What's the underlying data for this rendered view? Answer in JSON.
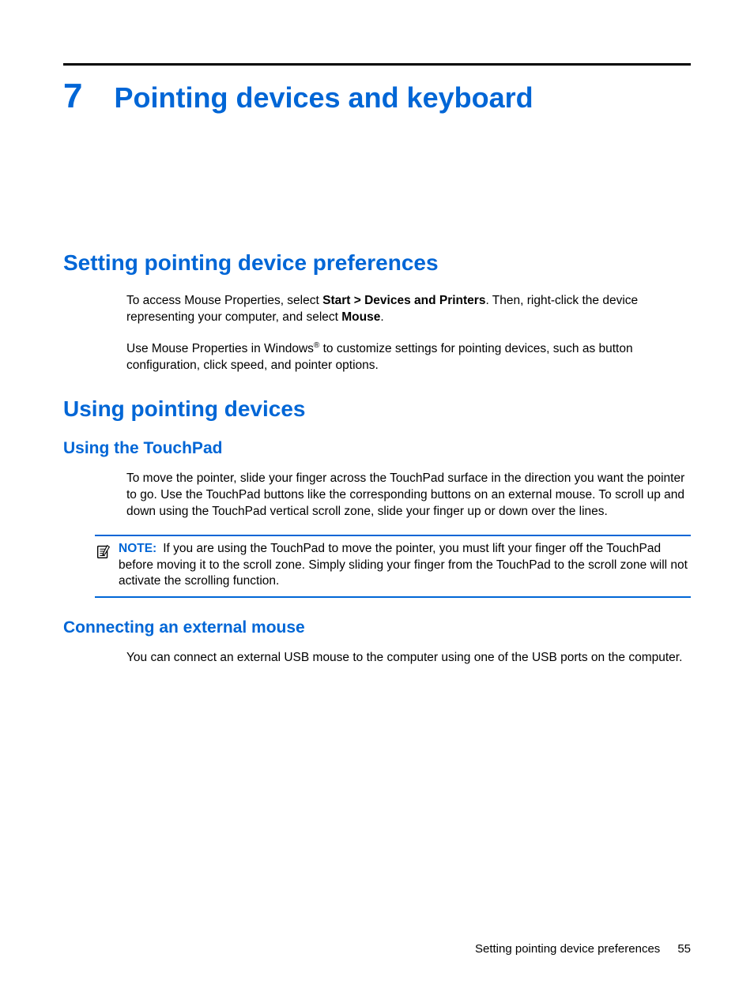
{
  "chapter": {
    "number": "7",
    "title": "Pointing devices and keyboard"
  },
  "sections": {
    "setting_prefs": {
      "heading": "Setting pointing device preferences",
      "para1_pre": "To access Mouse Properties, select ",
      "para1_b1": "Start > Devices and Printers",
      "para1_mid": ". Then, right-click the device representing your computer, and select ",
      "para1_b2": "Mouse",
      "para1_end": ".",
      "para2_pre": "Use Mouse Properties in Windows",
      "para2_sup": "®",
      "para2_post": " to customize settings for pointing devices, such as button configuration, click speed, and pointer options."
    },
    "using_devices": {
      "heading": "Using pointing devices",
      "touchpad": {
        "heading": "Using the TouchPad",
        "para": "To move the pointer, slide your finger across the TouchPad surface in the direction you want the pointer to go. Use the TouchPad buttons like the corresponding buttons on an external mouse. To scroll up and down using the TouchPad vertical scroll zone, slide your finger up or down over the lines.",
        "note_label": "NOTE:",
        "note_text": "If you are using the TouchPad to move the pointer, you must lift your finger off the TouchPad before moving it to the scroll zone. Simply sliding your finger from the TouchPad to the scroll zone will not activate the scrolling function."
      },
      "external_mouse": {
        "heading": "Connecting an external mouse",
        "para": "You can connect an external USB mouse to the computer using one of the USB ports on the computer."
      }
    }
  },
  "footer": {
    "section": "Setting pointing device preferences",
    "page": "55"
  }
}
